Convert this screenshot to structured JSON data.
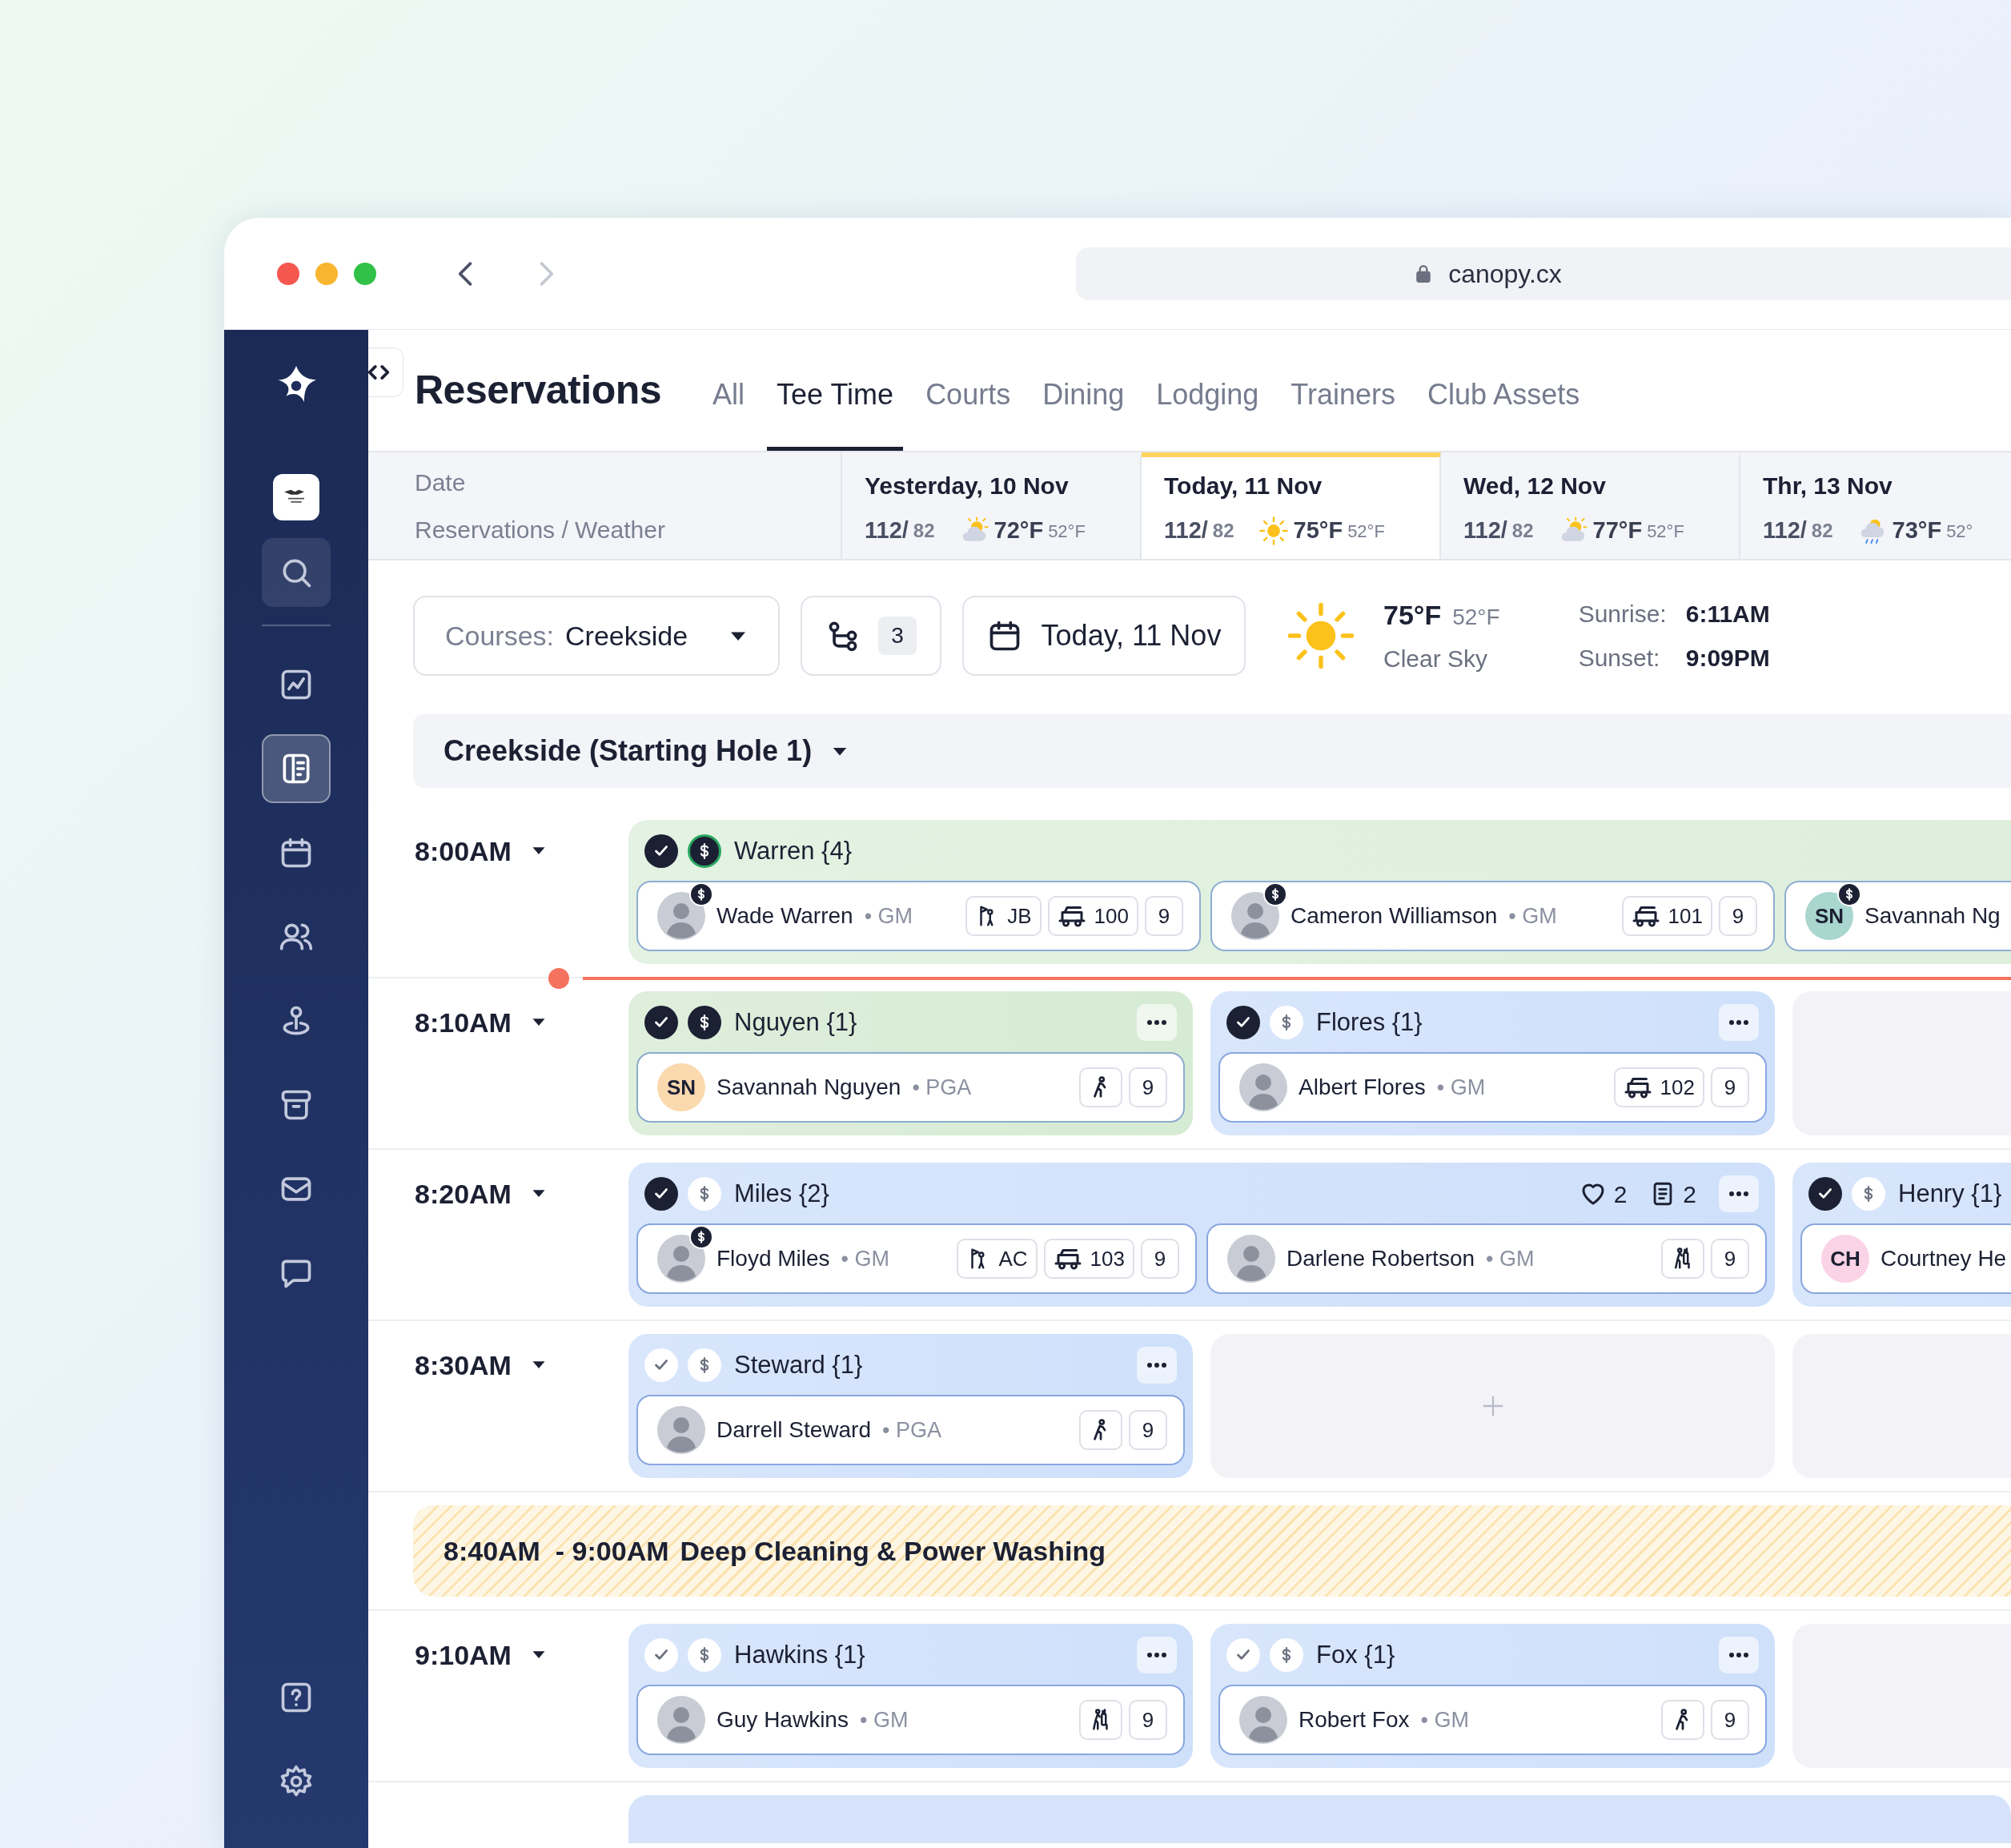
{
  "browser": {
    "url": "canopy.cx"
  },
  "sidebar": {
    "items": [
      {
        "kind": "search",
        "selected": false
      },
      {
        "kind": "chart",
        "selected": false
      },
      {
        "kind": "reservations",
        "selected": true
      },
      {
        "kind": "calendar",
        "selected": false
      },
      {
        "kind": "members",
        "selected": false
      },
      {
        "kind": "location",
        "selected": false
      },
      {
        "kind": "archive",
        "selected": false
      },
      {
        "kind": "mail",
        "selected": false
      },
      {
        "kind": "chat",
        "selected": false
      }
    ],
    "bottom_items": [
      {
        "kind": "help",
        "selected": false
      },
      {
        "kind": "settings",
        "selected": false
      }
    ]
  },
  "header": {
    "title": "Reservations",
    "tabs": [
      {
        "label": "All",
        "selected": false
      },
      {
        "label": "Tee Time",
        "selected": true
      },
      {
        "label": "Courts",
        "selected": false
      },
      {
        "label": "Dining",
        "selected": false
      },
      {
        "label": "Lodging",
        "selected": false
      },
      {
        "label": "Trainers",
        "selected": false
      },
      {
        "label": "Club Assets",
        "selected": false
      }
    ]
  },
  "date_strip": {
    "label": "Date",
    "sublabel": "Reservations / Weather",
    "days": [
      {
        "label": "Yesterday, 10 Nov",
        "booked": "112/",
        "capacity": "82",
        "weather": {
          "kind": "partly-cloudy"
        },
        "high": "72°F",
        "low": "52°F",
        "selected": false
      },
      {
        "label": "Today, 11 Nov",
        "booked": "112/",
        "capacity": "82",
        "weather": {
          "kind": "sunny"
        },
        "high": "75°F",
        "low": "52°F",
        "selected": true
      },
      {
        "label": "Wed, 12 Nov",
        "booked": "112/",
        "capacity": "82",
        "weather": {
          "kind": "partly-cloudy"
        },
        "high": "77°F",
        "low": "52°F",
        "selected": false
      },
      {
        "label": "Thr, 13 Nov",
        "booked": "112/",
        "capacity": "82",
        "weather": {
          "kind": "rain"
        },
        "high": "73°F",
        "low": "52°",
        "selected": false
      }
    ]
  },
  "filters": {
    "course_label": "Courses:",
    "course_value": "Creekside",
    "route_count": "3",
    "date": "Today, 11 Nov"
  },
  "weather": {
    "kind": "sunny",
    "temp": "75°F",
    "low": "52°F",
    "condition": "Clear Sky",
    "sunrise_label": "Sunrise:",
    "sunrise": "6:11AM",
    "sunset_label": "Sunset:",
    "sunset": "9:09PM"
  },
  "course_section": {
    "title": "Creekside (Starting Hole 1)"
  },
  "slots": [
    {
      "kind": "tee",
      "time": "8:00AM",
      "now_line": true,
      "groups": [
        {
          "kind": "booking",
          "name": "Warren {4}",
          "checked_in": true,
          "payment": {
            "kind": "full"
          },
          "color": "#dcefdb",
          "more": false,
          "players": [
            {
              "name": "Wade Warren",
              "role": "• GM",
              "avatar": {
                "kind": "photo"
              },
              "paid": true,
              "caddie": "JB",
              "transport": {
                "kind": "cart",
                "cart": "100"
              },
              "holes": "9"
            },
            {
              "name": "Cameron Williamson",
              "role": "• GM",
              "avatar": {
                "kind": "photo"
              },
              "paid": true,
              "transport": {
                "kind": "cart",
                "cart": "101"
              },
              "holes": "9"
            },
            {
              "name": "Savannah Ng",
              "avatar": {
                "kind": "initials",
                "initials": "SN",
                "color": "#a9d6cf"
              },
              "paid": true
            }
          ]
        }
      ]
    },
    {
      "kind": "tee",
      "time": "8:10AM",
      "now_line": false,
      "groups": [
        {
          "kind": "booking",
          "name": "Nguyen {1}",
          "checked_in": true,
          "payment": {
            "kind": "paid"
          },
          "color": "#d6ebd3",
          "more": true,
          "players": [
            {
              "name": "Savannah Nguyen",
              "role": "• PGA",
              "avatar": {
                "kind": "initials",
                "initials": "SN",
                "color": "#fbd9ae"
              },
              "paid": false,
              "transport": {
                "kind": "walk"
              },
              "holes": "9"
            }
          ]
        },
        {
          "kind": "booking",
          "name": "Flores {1}",
          "checked_in": true,
          "payment": {
            "kind": "none"
          },
          "color": "#cfe0fb",
          "more": true,
          "players": [
            {
              "name": "Albert Flores",
              "role": "• GM",
              "avatar": {
                "kind": "photo"
              },
              "paid": false,
              "transport": {
                "kind": "cart",
                "cart": "102"
              },
              "holes": "9"
            }
          ]
        },
        {
          "kind": "empty"
        }
      ]
    },
    {
      "kind": "tee",
      "time": "8:20AM",
      "now_line": false,
      "groups": [
        {
          "kind": "booking",
          "name": "Miles {2}",
          "checked_in": true,
          "payment": {
            "kind": "none"
          },
          "color": "#cfe0fb",
          "more": true,
          "likes": "2",
          "notes": "2",
          "players": [
            {
              "name": "Floyd Miles",
              "role": "• GM",
              "avatar": {
                "kind": "photo"
              },
              "paid": true,
              "caddie": "AC",
              "transport": {
                "kind": "cart",
                "cart": "103"
              },
              "holes": "9"
            },
            {
              "name": "Darlene Robertson",
              "role": "• GM",
              "avatar": {
                "kind": "photo"
              },
              "paid": false,
              "transport": {
                "kind": "bag"
              },
              "holes": "9"
            }
          ]
        },
        {
          "kind": "booking",
          "name": "Henry {1}",
          "checked_in": true,
          "payment": {
            "kind": "none"
          },
          "color": "#cfe0fb",
          "more": false,
          "players": [
            {
              "name": "Courtney He",
              "avatar": {
                "kind": "initials",
                "initials": "CH",
                "color": "#fbd3e6"
              },
              "paid": false
            }
          ]
        }
      ]
    },
    {
      "kind": "tee",
      "time": "8:30AM",
      "now_line": false,
      "groups": [
        {
          "kind": "booking",
          "name": "Steward {1}",
          "checked_in": false,
          "payment": {
            "kind": "none"
          },
          "color": "#cfe0fb",
          "more": true,
          "players": [
            {
              "name": "Darrell Steward",
              "role": "• PGA",
              "avatar": {
                "kind": "photo"
              },
              "paid": false,
              "transport": {
                "kind": "walk"
              },
              "holes": "9"
            }
          ]
        },
        {
          "kind": "add-slot"
        },
        {
          "kind": "empty"
        }
      ]
    },
    {
      "kind": "block",
      "time_range": "8:40AM  - 9:00AM",
      "title": "Deep Cleaning & Power Washing"
    },
    {
      "kind": "tee",
      "time": "9:10AM",
      "now_line": false,
      "groups": [
        {
          "kind": "booking",
          "name": "Hawkins {1}",
          "checked_in": false,
          "payment": {
            "kind": "none"
          },
          "color": "#cfe0fb",
          "more": true,
          "players": [
            {
              "name": "Guy Hawkins",
              "role": "• GM",
              "avatar": {
                "kind": "photo"
              },
              "paid": false,
              "transport": {
                "kind": "bag"
              },
              "holes": "9"
            }
          ]
        },
        {
          "kind": "booking",
          "name": "Fox {1}",
          "checked_in": false,
          "payment": {
            "kind": "none"
          },
          "color": "#cfe0fb",
          "more": true,
          "players": [
            {
              "name": "Robert Fox",
              "role": "• GM",
              "avatar": {
                "kind": "photo"
              },
              "paid": false,
              "transport": {
                "kind": "walk"
              },
              "holes": "9"
            }
          ]
        },
        {
          "kind": "empty"
        }
      ]
    },
    {
      "kind": "partial",
      "color": "#d6e3fb"
    }
  ]
}
